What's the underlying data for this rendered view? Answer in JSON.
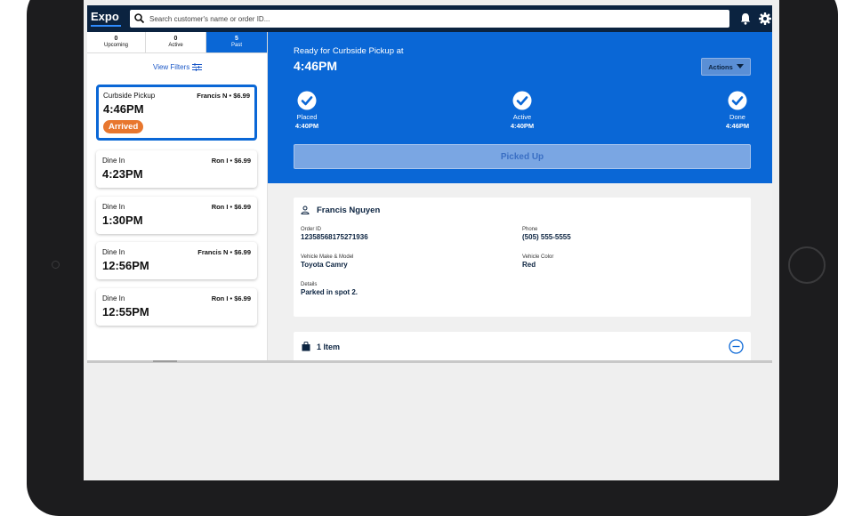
{
  "header": {
    "logo": "Expo",
    "search_placeholder": "Search customer's name or order ID...",
    "icons": [
      "search-icon",
      "bell-icon",
      "gear-icon"
    ]
  },
  "tabs": [
    {
      "count": "0",
      "label": "Upcoming"
    },
    {
      "count": "0",
      "label": "Active"
    },
    {
      "count": "5",
      "label": "Past"
    }
  ],
  "filters": {
    "label": "View Filters",
    "icon": "sliders-icon"
  },
  "orders": [
    {
      "type": "Curbside Pickup",
      "who": "Francis N • $6.99",
      "time": "4:46PM",
      "badge": "Arrived"
    },
    {
      "type": "Dine In",
      "who": "Ron I • $6.99",
      "time": "4:23PM"
    },
    {
      "type": "Dine In",
      "who": "Ron I • $6.99",
      "time": "1:30PM"
    },
    {
      "type": "Dine In",
      "who": "Francis N • $6.99",
      "time": "12:56PM"
    },
    {
      "type": "Dine In",
      "who": "Ron I • $6.99",
      "time": "12:55PM"
    }
  ],
  "status": {
    "heading": "Ready for Curbside Pickup at",
    "time": "4:46PM",
    "actions_label": "Actions",
    "steps": [
      {
        "label": "Placed",
        "time": "4:40PM"
      },
      {
        "label": "Active",
        "time": "4:40PM"
      },
      {
        "label": "Done",
        "time": "4:46PM"
      }
    ],
    "picked_up_label": "Picked Up"
  },
  "customer": {
    "name": "Francis Nguyen",
    "order_id_label": "Order ID",
    "order_id": "12358568175271936",
    "phone_label": "Phone",
    "phone": "(505) 555-5555",
    "vehicle_label": "Vehicle Make & Model",
    "vehicle": "Toyota Camry",
    "color_label": "Vehicle Color",
    "color": "Red",
    "details_label": "Details",
    "details": "Parked in spot 2."
  },
  "items": {
    "label": "1 Item"
  },
  "colors": {
    "primary": "#0a67d6",
    "header": "#0b2340",
    "badge": "#e8772e"
  }
}
